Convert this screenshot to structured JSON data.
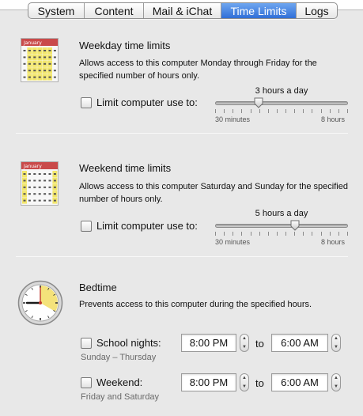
{
  "tabs": [
    {
      "label": "System",
      "selected": false
    },
    {
      "label": "Content",
      "selected": false
    },
    {
      "label": "Mail & iChat",
      "selected": false
    },
    {
      "label": "Time Limits",
      "selected": true
    },
    {
      "label": "Logs",
      "selected": false
    }
  ],
  "weekday": {
    "icon_month": "January",
    "title": "Weekday time limits",
    "description": "Allows access to this computer Monday through Friday for the specified number of hours only.",
    "checkbox_label": "Limit computer use to:",
    "checked": false,
    "slider_value_text": "3 hours a day",
    "slider_fraction": 0.33,
    "slider_min_label": "30 minutes",
    "slider_max_label": "8 hours"
  },
  "weekend": {
    "icon_month": "January",
    "title": "Weekend time limits",
    "description": "Allows access to this computer Saturday and Sunday for the specified number of hours only.",
    "checkbox_label": "Limit computer use to:",
    "checked": false,
    "slider_value_text": "5 hours a day",
    "slider_fraction": 0.6,
    "slider_min_label": "30 minutes",
    "slider_max_label": "8 hours"
  },
  "bedtime": {
    "title": "Bedtime",
    "description": "Prevents access to this computer during the specified hours.",
    "school_nights": {
      "label": "School nights:",
      "sub_label": "Sunday – Thursday",
      "checked": false,
      "start": "8:00 PM",
      "to": "to",
      "end": "6:00 AM"
    },
    "weekend": {
      "label": "Weekend:",
      "sub_label": "Friday and Saturday",
      "checked": false,
      "start": "8:00 PM",
      "to": "to",
      "end": "6:00 AM"
    }
  },
  "colors": {
    "tab_selected": "#3d7fe0",
    "calendar_header": "#c94a4a",
    "calendar_highlight": "#f2e66b",
    "clock_face": "#f4e27a"
  }
}
